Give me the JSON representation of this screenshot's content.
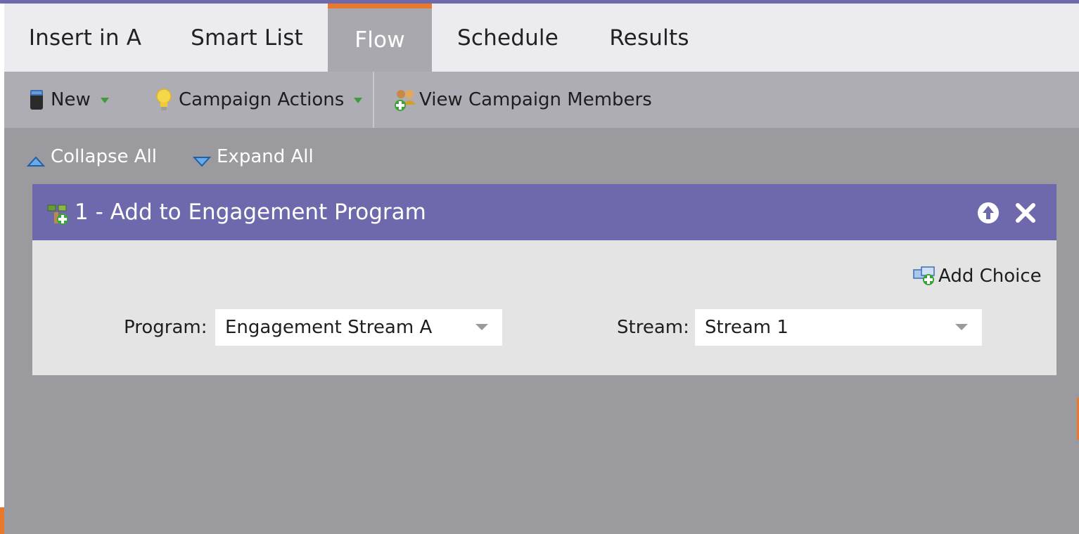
{
  "tabs": [
    {
      "label": "Insert in A",
      "active": false
    },
    {
      "label": "Smart List",
      "active": false
    },
    {
      "label": "Flow",
      "active": true
    },
    {
      "label": "Schedule",
      "active": false
    },
    {
      "label": "Results",
      "active": false
    }
  ],
  "toolbar": {
    "new_label": "New",
    "campaign_actions_label": "Campaign Actions",
    "view_members_label": "View Campaign Members"
  },
  "controls": {
    "collapse_all": "Collapse All",
    "expand_all": "Expand All"
  },
  "step": {
    "title": "1 - Add to Engagement Program",
    "add_choice": "Add Choice",
    "program_label": "Program:",
    "program_value": "Engagement Stream A",
    "stream_label": "Stream:",
    "stream_value": "Stream 1"
  },
  "icons": {
    "new": "document-icon",
    "campaign_actions": "lightbulb-icon",
    "view_members": "people-add-icon",
    "collapse": "triangle-up-icon",
    "expand": "triangle-down-icon",
    "step": "flow-step-icon",
    "move_up": "arrow-up-circle-icon",
    "remove": "close-icon",
    "add_choice": "add-choice-icon"
  },
  "colors": {
    "brand_purple": "#6e68ad",
    "accent_orange": "#e8792b",
    "tab_bar": "#ebebf0",
    "toolbar": "#aeadb3",
    "canvas": "#9b9a9f"
  }
}
